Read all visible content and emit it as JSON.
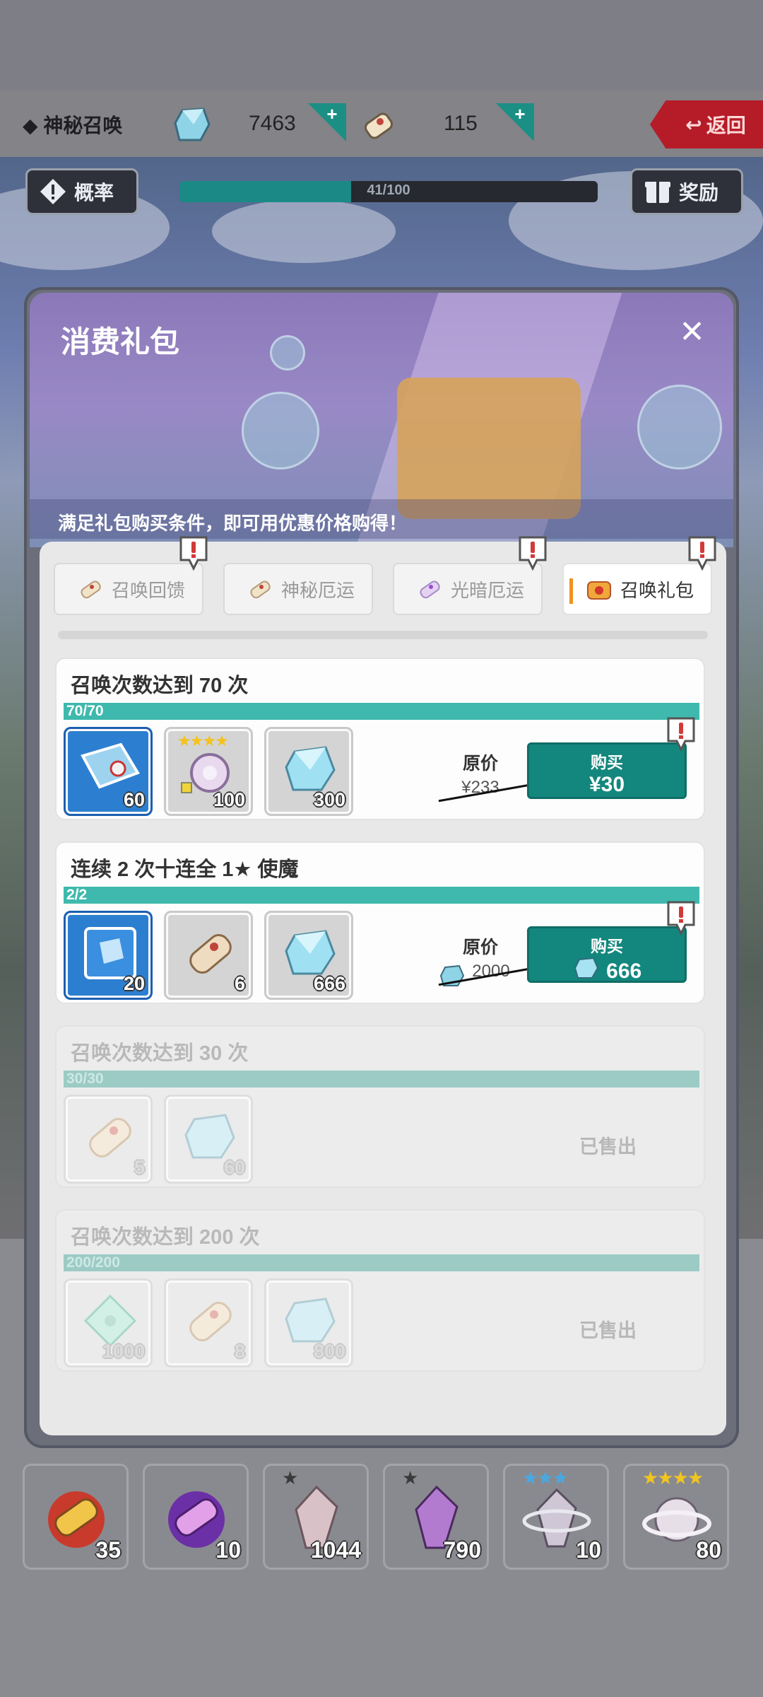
{
  "topbar": {
    "title": "◆ 神秘召唤",
    "gems": "7463",
    "scrolls": "115",
    "back_label": "返回"
  },
  "subbar": {
    "rate_label": "概率",
    "progress_text": "41/100",
    "progress_fraction": 0.41,
    "reward_label": "奖励"
  },
  "modal": {
    "title": "消费礼包",
    "close_label": "✕",
    "subtitle": "满足礼包购买条件，即可用优惠价格购得！",
    "tabs": [
      {
        "label": "召唤回馈",
        "icon": "scroll-icon",
        "active": false
      },
      {
        "label": "神秘厄运",
        "icon": "scroll-icon",
        "active": false
      },
      {
        "label": "光暗厄运",
        "icon": "purple-scroll-icon",
        "active": false
      },
      {
        "label": "召唤礼包",
        "icon": "gift-box-icon",
        "active": true
      }
    ],
    "packs": [
      {
        "title": "召唤次数达到 70 次",
        "progress": "70/70",
        "items": [
          {
            "icon": "map-icon",
            "count": "60"
          },
          {
            "icon": "orb-icon",
            "count": "100",
            "stars": "★★★★"
          },
          {
            "icon": "crystal-icon",
            "count": "300"
          }
        ],
        "orig_label": "原价",
        "orig_price": "¥233",
        "buy_label": "购买",
        "buy_price": "¥30"
      },
      {
        "title": "连续 2 次十连全 1★ 使魔",
        "progress": "2/2",
        "items": [
          {
            "icon": "blue-gem-card-icon",
            "count": "20"
          },
          {
            "icon": "scroll-icon",
            "count": "6"
          },
          {
            "icon": "crystal-icon",
            "count": "666"
          }
        ],
        "orig_label": "原价",
        "orig_price": "2000",
        "buy_label": "购买",
        "buy_price": "666"
      },
      {
        "title": "召唤次数达到 30 次",
        "progress": "30/30",
        "items": [
          {
            "icon": "scroll-icon",
            "count": "5"
          },
          {
            "icon": "crystal-icon",
            "count": "60"
          }
        ],
        "sold_label": "已售出"
      },
      {
        "title": "召唤次数达到 200 次",
        "progress": "200/200",
        "items": [
          {
            "icon": "green-diamond-icon",
            "count": "1000"
          },
          {
            "icon": "scroll-icon",
            "count": "8"
          },
          {
            "icon": "crystal-icon",
            "count": "800"
          }
        ],
        "sold_label": "已售出"
      }
    ]
  },
  "inventory": [
    {
      "icon": "red-scroll-icon",
      "count": "35"
    },
    {
      "icon": "purple-scroll-icon",
      "count": "10"
    },
    {
      "icon": "pink-shard-icon",
      "count": "1044",
      "stars": "★"
    },
    {
      "icon": "purple-shard-icon",
      "count": "790",
      "stars": "★"
    },
    {
      "icon": "ringed-shard-icon",
      "count": "10",
      "stars": "★★★"
    },
    {
      "icon": "ringed-orb-icon",
      "count": "80",
      "stars": "★★★★"
    }
  ],
  "colors": {
    "teal": "#13877d",
    "progress": "#3fb9ad",
    "accent_orange": "#f0921f",
    "back_red": "#b51c28"
  }
}
